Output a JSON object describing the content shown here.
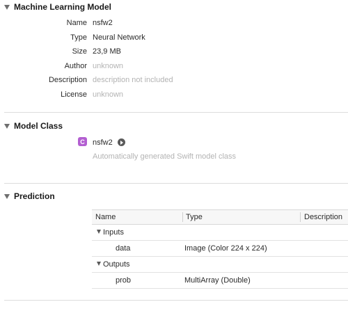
{
  "sections": {
    "model": {
      "title": "Machine Learning Model",
      "rows": [
        {
          "label": "Name",
          "value": "nsfw2",
          "muted": false
        },
        {
          "label": "Type",
          "value": "Neural Network",
          "muted": false
        },
        {
          "label": "Size",
          "value": "23,9 MB",
          "muted": false
        },
        {
          "label": "Author",
          "value": "unknown",
          "muted": true
        },
        {
          "label": "Description",
          "value": "description not included",
          "muted": true
        },
        {
          "label": "License",
          "value": "unknown",
          "muted": true
        }
      ]
    },
    "model_class": {
      "title": "Model Class",
      "badge": "C",
      "name": "nsfw2",
      "description": "Automatically generated Swift model class"
    },
    "prediction": {
      "title": "Prediction",
      "columns": {
        "name": "Name",
        "type": "Type",
        "description": "Description"
      },
      "groups": [
        {
          "label": "Inputs",
          "items": [
            {
              "name": "data",
              "type": "Image (Color 224 x 224)"
            }
          ]
        },
        {
          "label": "Outputs",
          "items": [
            {
              "name": "prob",
              "type": "MultiArray (Double)"
            }
          ]
        }
      ]
    }
  },
  "colors": {
    "class_badge": "#b35fd1",
    "muted_text": "#b3b3b3",
    "divider": "#dcdcdc"
  }
}
